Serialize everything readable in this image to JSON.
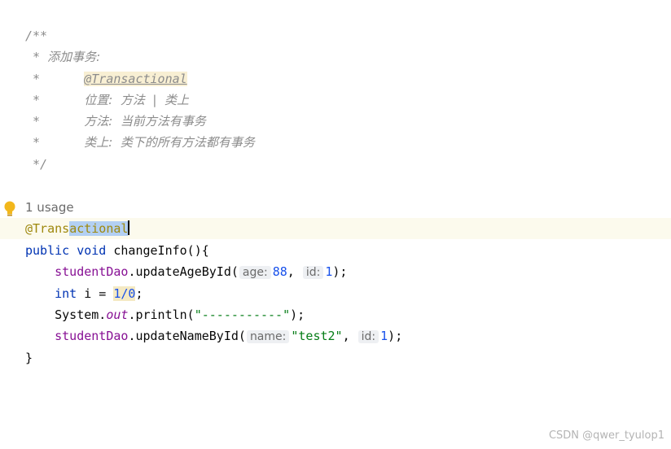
{
  "doc_comment": {
    "open": "/**",
    "line1_prefix": " * ",
    "line1_text": "添加事务:",
    "line2_prefix": " *      ",
    "line2_annotation": "@Transactional",
    "line3_prefix": " *      ",
    "line3_text": "位置:  方法  |  类上",
    "line4_prefix": " *      ",
    "line4_text": "方法:  当前方法有事务",
    "line5_prefix": " *      ",
    "line5_text": "类上:  类下的所有方法都有事务",
    "close": " */"
  },
  "usage_hint": "1 usage",
  "annotation_line": {
    "prefix": "@Trans",
    "selected": "actional"
  },
  "method_signature": {
    "modifier": "public",
    "return_type": "void",
    "name_and_params": " changeInfo(){"
  },
  "statement1": {
    "object": "studentDao",
    "call": ".updateAgeById(",
    "hint_age": "age:",
    "value_age": "88",
    "sep": ", ",
    "hint_id": "id:",
    "value_id": "1",
    "end": ");"
  },
  "statement2": {
    "type": "int",
    "rest": " i = ",
    "expr": "1/0",
    "end": ";"
  },
  "statement3": {
    "class": "System.",
    "field": "out",
    "call": ".println(",
    "string": "\"-----------\"",
    "end": ");"
  },
  "statement4": {
    "object": "studentDao",
    "call": ".updateNameById(",
    "hint_name": "name:",
    "value_name": "\"test2\"",
    "sep": ", ",
    "hint_id": "id:",
    "value_id": "1",
    "end": ");"
  },
  "closing_brace": "}",
  "watermark": "CSDN @qwer_tyulop1",
  "colors": {
    "keyword": "#0033b3",
    "field": "#871094",
    "number": "#1750eb",
    "string": "#067d17",
    "annotation": "#9e880d",
    "comment": "#8c8c8c",
    "selection": "#b3d0f3",
    "current_line": "#fcfaed",
    "bulb": "#f2b71c"
  }
}
